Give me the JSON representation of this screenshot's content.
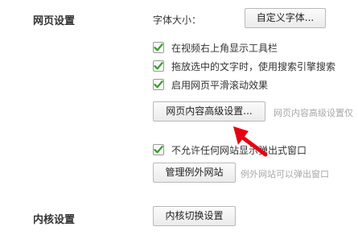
{
  "web_settings": {
    "section_title": "网页设置",
    "font_size_label": "字体大小：",
    "custom_font_button": "自定义字体...",
    "checkboxes": [
      {
        "label": "在视频右上角显示工具栏",
        "checked": true
      },
      {
        "label": "拖放选中的文字时，使用搜索引擎搜索",
        "checked": true
      },
      {
        "label": "启用网页平滑滚动效果",
        "checked": true
      }
    ],
    "advanced_button": "网页内容高级设置...",
    "advanced_hint": "网页内容高级设置仅",
    "popup_checkbox": {
      "label": "不允许任何网站显示弹出式窗口",
      "checked": true
    },
    "manage_exceptions_button": "管理例外网站",
    "exceptions_hint": "例外网站可以弹出窗口"
  },
  "kernel_settings": {
    "section_title": "内核设置",
    "switch_button": "内核切换设置"
  },
  "colors": {
    "checkmark": "#3a9a2d",
    "arrow": "#e60012"
  }
}
